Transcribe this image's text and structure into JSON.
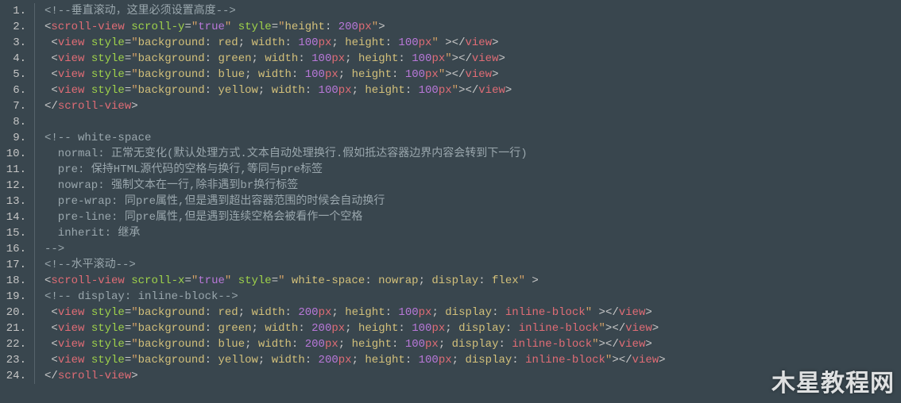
{
  "watermark": "木星教程网",
  "gutter": [
    "1.",
    "2.",
    "3.",
    "4.",
    "5.",
    "6.",
    "7.",
    "8.",
    "9.",
    "10.",
    "11.",
    "12.",
    "13.",
    "14.",
    "15.",
    "16.",
    "17.",
    "18.",
    "19.",
    "20.",
    "21.",
    "22.",
    "23.",
    "24."
  ],
  "lines": [
    [
      {
        "cls": "c-comment",
        "t": "<!--垂直滚动，这里必须设置高度-->"
      }
    ],
    [
      {
        "cls": "c-punc",
        "t": "<"
      },
      {
        "cls": "c-tag",
        "t": "scroll-view"
      },
      {
        "cls": "",
        "t": " "
      },
      {
        "cls": "c-attr",
        "t": "scroll-y"
      },
      {
        "cls": "c-eq",
        "t": "="
      },
      {
        "cls": "c-str",
        "t": "\""
      },
      {
        "cls": "c-num",
        "t": "true"
      },
      {
        "cls": "c-str",
        "t": "\""
      },
      {
        "cls": "",
        "t": " "
      },
      {
        "cls": "c-attr",
        "t": "style"
      },
      {
        "cls": "c-eq",
        "t": "="
      },
      {
        "cls": "c-str",
        "t": "\""
      },
      {
        "cls": "c-prop",
        "t": "height"
      },
      {
        "cls": "c-punc",
        "t": ": "
      },
      {
        "cls": "c-num",
        "t": "200"
      },
      {
        "cls": "c-unit",
        "t": "px"
      },
      {
        "cls": "c-str",
        "t": "\""
      },
      {
        "cls": "c-punc",
        "t": ">"
      }
    ],
    [
      {
        "cls": "",
        "t": " "
      },
      {
        "cls": "c-punc",
        "t": "<"
      },
      {
        "cls": "c-tag",
        "t": "view"
      },
      {
        "cls": "",
        "t": " "
      },
      {
        "cls": "c-attr",
        "t": "style"
      },
      {
        "cls": "c-eq",
        "t": "="
      },
      {
        "cls": "c-str",
        "t": "\""
      },
      {
        "cls": "c-prop",
        "t": "background"
      },
      {
        "cls": "c-punc",
        "t": ": "
      },
      {
        "cls": "c-prop",
        "t": "red"
      },
      {
        "cls": "c-punc",
        "t": "; "
      },
      {
        "cls": "c-prop",
        "t": "width"
      },
      {
        "cls": "c-punc",
        "t": ": "
      },
      {
        "cls": "c-num",
        "t": "100"
      },
      {
        "cls": "c-unit",
        "t": "px"
      },
      {
        "cls": "c-punc",
        "t": "; "
      },
      {
        "cls": "c-prop",
        "t": "height"
      },
      {
        "cls": "c-punc",
        "t": ": "
      },
      {
        "cls": "c-num",
        "t": "100"
      },
      {
        "cls": "c-unit",
        "t": "px"
      },
      {
        "cls": "c-str",
        "t": "\""
      },
      {
        "cls": "c-punc",
        "t": " >"
      },
      {
        "cls": "c-punc",
        "t": "</"
      },
      {
        "cls": "c-tag",
        "t": "view"
      },
      {
        "cls": "c-punc",
        "t": ">"
      }
    ],
    [
      {
        "cls": "",
        "t": " "
      },
      {
        "cls": "c-punc",
        "t": "<"
      },
      {
        "cls": "c-tag",
        "t": "view"
      },
      {
        "cls": "",
        "t": " "
      },
      {
        "cls": "c-attr",
        "t": "style"
      },
      {
        "cls": "c-eq",
        "t": "="
      },
      {
        "cls": "c-str",
        "t": "\""
      },
      {
        "cls": "c-prop",
        "t": "background"
      },
      {
        "cls": "c-punc",
        "t": ": "
      },
      {
        "cls": "c-prop",
        "t": "green"
      },
      {
        "cls": "c-punc",
        "t": "; "
      },
      {
        "cls": "c-prop",
        "t": "width"
      },
      {
        "cls": "c-punc",
        "t": ": "
      },
      {
        "cls": "c-num",
        "t": "100"
      },
      {
        "cls": "c-unit",
        "t": "px"
      },
      {
        "cls": "c-punc",
        "t": "; "
      },
      {
        "cls": "c-prop",
        "t": "height"
      },
      {
        "cls": "c-punc",
        "t": ": "
      },
      {
        "cls": "c-num",
        "t": "100"
      },
      {
        "cls": "c-unit",
        "t": "px"
      },
      {
        "cls": "c-str",
        "t": "\""
      },
      {
        "cls": "c-punc",
        "t": ">"
      },
      {
        "cls": "c-punc",
        "t": "</"
      },
      {
        "cls": "c-tag",
        "t": "view"
      },
      {
        "cls": "c-punc",
        "t": ">"
      }
    ],
    [
      {
        "cls": "",
        "t": " "
      },
      {
        "cls": "c-punc",
        "t": "<"
      },
      {
        "cls": "c-tag",
        "t": "view"
      },
      {
        "cls": "",
        "t": " "
      },
      {
        "cls": "c-attr",
        "t": "style"
      },
      {
        "cls": "c-eq",
        "t": "="
      },
      {
        "cls": "c-str",
        "t": "\""
      },
      {
        "cls": "c-prop",
        "t": "background"
      },
      {
        "cls": "c-punc",
        "t": ": "
      },
      {
        "cls": "c-prop",
        "t": "blue"
      },
      {
        "cls": "c-punc",
        "t": "; "
      },
      {
        "cls": "c-prop",
        "t": "width"
      },
      {
        "cls": "c-punc",
        "t": ": "
      },
      {
        "cls": "c-num",
        "t": "100"
      },
      {
        "cls": "c-unit",
        "t": "px"
      },
      {
        "cls": "c-punc",
        "t": "; "
      },
      {
        "cls": "c-prop",
        "t": "height"
      },
      {
        "cls": "c-punc",
        "t": ": "
      },
      {
        "cls": "c-num",
        "t": "100"
      },
      {
        "cls": "c-unit",
        "t": "px"
      },
      {
        "cls": "c-str",
        "t": "\""
      },
      {
        "cls": "c-punc",
        "t": ">"
      },
      {
        "cls": "c-punc",
        "t": "</"
      },
      {
        "cls": "c-tag",
        "t": "view"
      },
      {
        "cls": "c-punc",
        "t": ">"
      }
    ],
    [
      {
        "cls": "",
        "t": " "
      },
      {
        "cls": "c-punc",
        "t": "<"
      },
      {
        "cls": "c-tag",
        "t": "view"
      },
      {
        "cls": "",
        "t": " "
      },
      {
        "cls": "c-attr",
        "t": "style"
      },
      {
        "cls": "c-eq",
        "t": "="
      },
      {
        "cls": "c-str",
        "t": "\""
      },
      {
        "cls": "c-prop",
        "t": "background"
      },
      {
        "cls": "c-punc",
        "t": ": "
      },
      {
        "cls": "c-prop",
        "t": "yellow"
      },
      {
        "cls": "c-punc",
        "t": "; "
      },
      {
        "cls": "c-prop",
        "t": "width"
      },
      {
        "cls": "c-punc",
        "t": ": "
      },
      {
        "cls": "c-num",
        "t": "100"
      },
      {
        "cls": "c-unit",
        "t": "px"
      },
      {
        "cls": "c-punc",
        "t": "; "
      },
      {
        "cls": "c-prop",
        "t": "height"
      },
      {
        "cls": "c-punc",
        "t": ": "
      },
      {
        "cls": "c-num",
        "t": "100"
      },
      {
        "cls": "c-unit",
        "t": "px"
      },
      {
        "cls": "c-str",
        "t": "\""
      },
      {
        "cls": "c-punc",
        "t": ">"
      },
      {
        "cls": "c-punc",
        "t": "</"
      },
      {
        "cls": "c-tag",
        "t": "view"
      },
      {
        "cls": "c-punc",
        "t": ">"
      }
    ],
    [
      {
        "cls": "c-punc",
        "t": "</"
      },
      {
        "cls": "c-tag",
        "t": "scroll-view"
      },
      {
        "cls": "c-punc",
        "t": ">"
      }
    ],
    [
      {
        "cls": "",
        "t": ""
      }
    ],
    [
      {
        "cls": "c-comment",
        "t": "<!-- white-space"
      }
    ],
    [
      {
        "cls": "c-comment",
        "t": "  normal: 正常无变化(默认处理方式.文本自动处理换行.假如抵达容器边界内容会转到下一行)"
      }
    ],
    [
      {
        "cls": "c-comment",
        "t": "  pre: 保持HTML源代码的空格与换行,等同与pre标签"
      }
    ],
    [
      {
        "cls": "c-comment",
        "t": "  nowrap: 强制文本在一行,除非遇到br换行标签"
      }
    ],
    [
      {
        "cls": "c-comment",
        "t": "  pre-wrap: 同pre属性,但是遇到超出容器范围的时候会自动换行"
      }
    ],
    [
      {
        "cls": "c-comment",
        "t": "  pre-line: 同pre属性,但是遇到连续空格会被看作一个空格"
      }
    ],
    [
      {
        "cls": "c-comment",
        "t": "  inherit: 继承"
      }
    ],
    [
      {
        "cls": "c-comment",
        "t": "-->"
      }
    ],
    [
      {
        "cls": "c-comment",
        "t": "<!--水平滚动-->"
      }
    ],
    [
      {
        "cls": "c-punc",
        "t": "<"
      },
      {
        "cls": "c-tag",
        "t": "scroll-view"
      },
      {
        "cls": "",
        "t": " "
      },
      {
        "cls": "c-attr",
        "t": "scroll-x"
      },
      {
        "cls": "c-eq",
        "t": "="
      },
      {
        "cls": "c-str",
        "t": "\""
      },
      {
        "cls": "c-num",
        "t": "true"
      },
      {
        "cls": "c-str",
        "t": "\""
      },
      {
        "cls": "",
        "t": " "
      },
      {
        "cls": "c-attr",
        "t": "style"
      },
      {
        "cls": "c-eq",
        "t": "="
      },
      {
        "cls": "c-str",
        "t": "\" "
      },
      {
        "cls": "c-prop",
        "t": "white-space"
      },
      {
        "cls": "c-punc",
        "t": ": "
      },
      {
        "cls": "c-prop",
        "t": "nowrap"
      },
      {
        "cls": "c-punc",
        "t": "; "
      },
      {
        "cls": "c-prop",
        "t": "display"
      },
      {
        "cls": "c-punc",
        "t": ": "
      },
      {
        "cls": "c-prop",
        "t": "flex"
      },
      {
        "cls": "c-str",
        "t": "\""
      },
      {
        "cls": "c-punc",
        "t": " >"
      }
    ],
    [
      {
        "cls": "c-comment",
        "t": "<!-- display: inline-block-->"
      }
    ],
    [
      {
        "cls": "",
        "t": " "
      },
      {
        "cls": "c-punc",
        "t": "<"
      },
      {
        "cls": "c-tag",
        "t": "view"
      },
      {
        "cls": "",
        "t": " "
      },
      {
        "cls": "c-attr",
        "t": "style"
      },
      {
        "cls": "c-eq",
        "t": "="
      },
      {
        "cls": "c-str",
        "t": "\""
      },
      {
        "cls": "c-prop",
        "t": "background"
      },
      {
        "cls": "c-punc",
        "t": ": "
      },
      {
        "cls": "c-prop",
        "t": "red"
      },
      {
        "cls": "c-punc",
        "t": "; "
      },
      {
        "cls": "c-prop",
        "t": "width"
      },
      {
        "cls": "c-punc",
        "t": ": "
      },
      {
        "cls": "c-num",
        "t": "200"
      },
      {
        "cls": "c-unit",
        "t": "px"
      },
      {
        "cls": "c-punc",
        "t": "; "
      },
      {
        "cls": "c-prop",
        "t": "height"
      },
      {
        "cls": "c-punc",
        "t": ": "
      },
      {
        "cls": "c-num",
        "t": "100"
      },
      {
        "cls": "c-unit",
        "t": "px"
      },
      {
        "cls": "c-punc",
        "t": "; "
      },
      {
        "cls": "c-prop",
        "t": "display"
      },
      {
        "cls": "c-punc",
        "t": ": "
      },
      {
        "cls": "c-tag",
        "t": "inline-block"
      },
      {
        "cls": "c-str",
        "t": "\""
      },
      {
        "cls": "c-punc",
        "t": " >"
      },
      {
        "cls": "c-punc",
        "t": "</"
      },
      {
        "cls": "c-tag",
        "t": "view"
      },
      {
        "cls": "c-punc",
        "t": ">"
      }
    ],
    [
      {
        "cls": "",
        "t": " "
      },
      {
        "cls": "c-punc",
        "t": "<"
      },
      {
        "cls": "c-tag",
        "t": "view"
      },
      {
        "cls": "",
        "t": " "
      },
      {
        "cls": "c-attr",
        "t": "style"
      },
      {
        "cls": "c-eq",
        "t": "="
      },
      {
        "cls": "c-str",
        "t": "\""
      },
      {
        "cls": "c-prop",
        "t": "background"
      },
      {
        "cls": "c-punc",
        "t": ": "
      },
      {
        "cls": "c-prop",
        "t": "green"
      },
      {
        "cls": "c-punc",
        "t": "; "
      },
      {
        "cls": "c-prop",
        "t": "width"
      },
      {
        "cls": "c-punc",
        "t": ": "
      },
      {
        "cls": "c-num",
        "t": "200"
      },
      {
        "cls": "c-unit",
        "t": "px"
      },
      {
        "cls": "c-punc",
        "t": "; "
      },
      {
        "cls": "c-prop",
        "t": "height"
      },
      {
        "cls": "c-punc",
        "t": ": "
      },
      {
        "cls": "c-num",
        "t": "100"
      },
      {
        "cls": "c-unit",
        "t": "px"
      },
      {
        "cls": "c-punc",
        "t": "; "
      },
      {
        "cls": "c-prop",
        "t": "display"
      },
      {
        "cls": "c-punc",
        "t": ": "
      },
      {
        "cls": "c-tag",
        "t": "inline-block"
      },
      {
        "cls": "c-str",
        "t": "\""
      },
      {
        "cls": "c-punc",
        "t": ">"
      },
      {
        "cls": "c-punc",
        "t": "</"
      },
      {
        "cls": "c-tag",
        "t": "view"
      },
      {
        "cls": "c-punc",
        "t": ">"
      }
    ],
    [
      {
        "cls": "",
        "t": " "
      },
      {
        "cls": "c-punc",
        "t": "<"
      },
      {
        "cls": "c-tag",
        "t": "view"
      },
      {
        "cls": "",
        "t": " "
      },
      {
        "cls": "c-attr",
        "t": "style"
      },
      {
        "cls": "c-eq",
        "t": "="
      },
      {
        "cls": "c-str",
        "t": "\""
      },
      {
        "cls": "c-prop",
        "t": "background"
      },
      {
        "cls": "c-punc",
        "t": ": "
      },
      {
        "cls": "c-prop",
        "t": "blue"
      },
      {
        "cls": "c-punc",
        "t": "; "
      },
      {
        "cls": "c-prop",
        "t": "width"
      },
      {
        "cls": "c-punc",
        "t": ": "
      },
      {
        "cls": "c-num",
        "t": "200"
      },
      {
        "cls": "c-unit",
        "t": "px"
      },
      {
        "cls": "c-punc",
        "t": "; "
      },
      {
        "cls": "c-prop",
        "t": "height"
      },
      {
        "cls": "c-punc",
        "t": ": "
      },
      {
        "cls": "c-num",
        "t": "100"
      },
      {
        "cls": "c-unit",
        "t": "px"
      },
      {
        "cls": "c-punc",
        "t": "; "
      },
      {
        "cls": "c-prop",
        "t": "display"
      },
      {
        "cls": "c-punc",
        "t": ": "
      },
      {
        "cls": "c-tag",
        "t": "inline-block"
      },
      {
        "cls": "c-str",
        "t": "\""
      },
      {
        "cls": "c-punc",
        "t": ">"
      },
      {
        "cls": "c-punc",
        "t": "</"
      },
      {
        "cls": "c-tag",
        "t": "view"
      },
      {
        "cls": "c-punc",
        "t": ">"
      }
    ],
    [
      {
        "cls": "",
        "t": " "
      },
      {
        "cls": "c-punc",
        "t": "<"
      },
      {
        "cls": "c-tag",
        "t": "view"
      },
      {
        "cls": "",
        "t": " "
      },
      {
        "cls": "c-attr",
        "t": "style"
      },
      {
        "cls": "c-eq",
        "t": "="
      },
      {
        "cls": "c-str",
        "t": "\""
      },
      {
        "cls": "c-prop",
        "t": "background"
      },
      {
        "cls": "c-punc",
        "t": ": "
      },
      {
        "cls": "c-prop",
        "t": "yellow"
      },
      {
        "cls": "c-punc",
        "t": "; "
      },
      {
        "cls": "c-prop",
        "t": "width"
      },
      {
        "cls": "c-punc",
        "t": ": "
      },
      {
        "cls": "c-num",
        "t": "200"
      },
      {
        "cls": "c-unit",
        "t": "px"
      },
      {
        "cls": "c-punc",
        "t": "; "
      },
      {
        "cls": "c-prop",
        "t": "height"
      },
      {
        "cls": "c-punc",
        "t": ": "
      },
      {
        "cls": "c-num",
        "t": "100"
      },
      {
        "cls": "c-unit",
        "t": "px"
      },
      {
        "cls": "c-punc",
        "t": "; "
      },
      {
        "cls": "c-prop",
        "t": "display"
      },
      {
        "cls": "c-punc",
        "t": ": "
      },
      {
        "cls": "c-tag",
        "t": "inline-block"
      },
      {
        "cls": "c-str",
        "t": "\""
      },
      {
        "cls": "c-punc",
        "t": ">"
      },
      {
        "cls": "c-punc",
        "t": "</"
      },
      {
        "cls": "c-tag",
        "t": "view"
      },
      {
        "cls": "c-punc",
        "t": ">"
      }
    ],
    [
      {
        "cls": "c-punc",
        "t": "</"
      },
      {
        "cls": "c-tag",
        "t": "scroll-view"
      },
      {
        "cls": "c-punc",
        "t": ">"
      }
    ]
  ]
}
